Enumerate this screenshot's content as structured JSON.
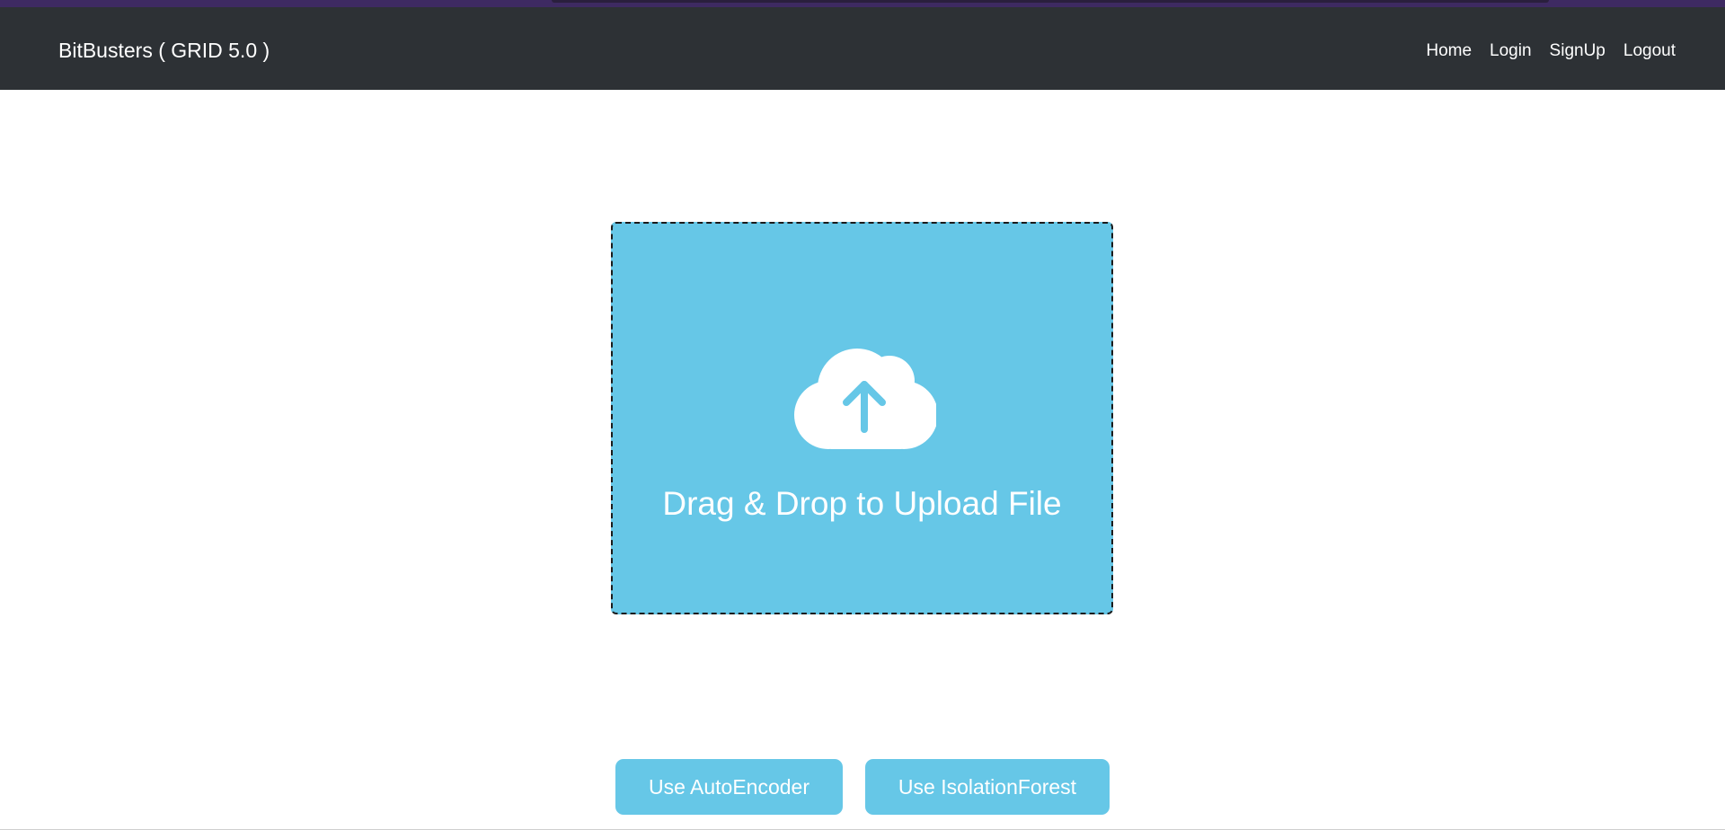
{
  "navbar": {
    "brand": "BitBusters ( GRID 5.0 )",
    "links": [
      {
        "label": "Home"
      },
      {
        "label": "Login"
      },
      {
        "label": "SignUp"
      },
      {
        "label": "Logout"
      }
    ]
  },
  "upload": {
    "icon": "cloud-upload-icon",
    "text": "Drag & Drop to Upload File"
  },
  "actions": {
    "autoencoder_label": "Use AutoEncoder",
    "isolationforest_label": "Use IsolationForest"
  },
  "colors": {
    "navbar_bg": "#2d3135",
    "accent": "#66c7e7",
    "top_strip": "#3e2a62"
  }
}
